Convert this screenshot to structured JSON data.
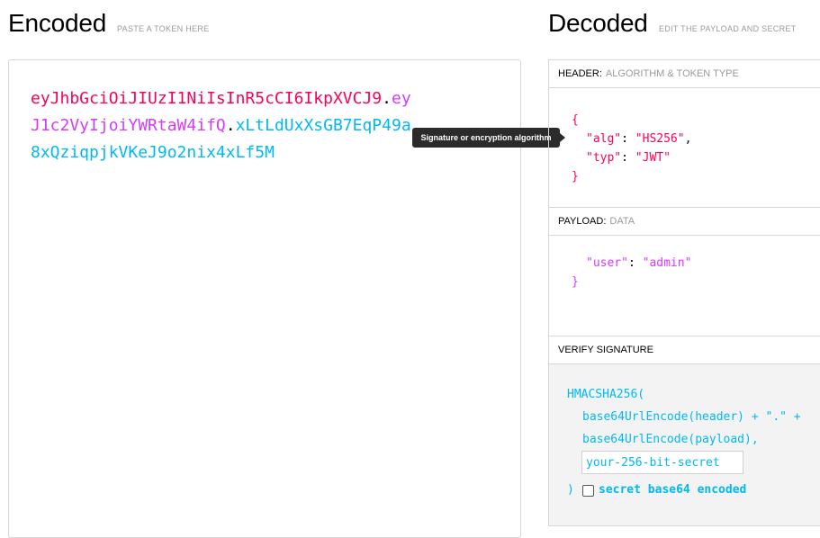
{
  "encoded": {
    "title": "Encoded",
    "subtitle": "PASTE A TOKEN HERE",
    "token_lines": [
      {
        "header": "eyJhbGciOiJIUzI1NiIsInR5cCI6IkpXVCJ9",
        "dot1": ".",
        "payload": "ey"
      },
      {
        "payload": "J1c2VyIjoiYWRtaW4ifQ",
        "dot2": ".",
        "sig": "xLtLdUxXsGB7EqP49a"
      },
      {
        "sig": "8xQziqpjkVKeJ9o2nix4xLf5M"
      }
    ],
    "tooltip": "Signature or encryption algorithm"
  },
  "decoded": {
    "title": "Decoded",
    "subtitle": "EDIT THE PAYLOAD AND SECRET",
    "header_panel": {
      "label": "HEADER:",
      "sublabel": "ALGORITHM & TOKEN TYPE",
      "lines": [
        "{",
        "\"alg\"",
        ": ",
        "\"HS256\"",
        ",",
        "\"typ\"",
        ": ",
        "\"JWT\"",
        "}"
      ]
    },
    "payload_panel": {
      "label": "PAYLOAD:",
      "sublabel": "DATA",
      "key": "\"user\"",
      "sep": ": ",
      "value": "\"admin\"",
      "close": "}"
    },
    "verify_panel": {
      "label": "VERIFY SIGNATURE",
      "fn": "HMACSHA256(",
      "line1": "base64UrlEncode(header) + \".\" +",
      "line2": "base64UrlEncode(payload),",
      "secret_placeholder": "your-256-bit-secret",
      "close": ")",
      "checkbox_label": "secret base64 encoded",
      "checkbox_checked": false
    }
  },
  "colors": {
    "header": "#fb015b",
    "payload": "#d63aff",
    "signature": "#00b9f1"
  }
}
